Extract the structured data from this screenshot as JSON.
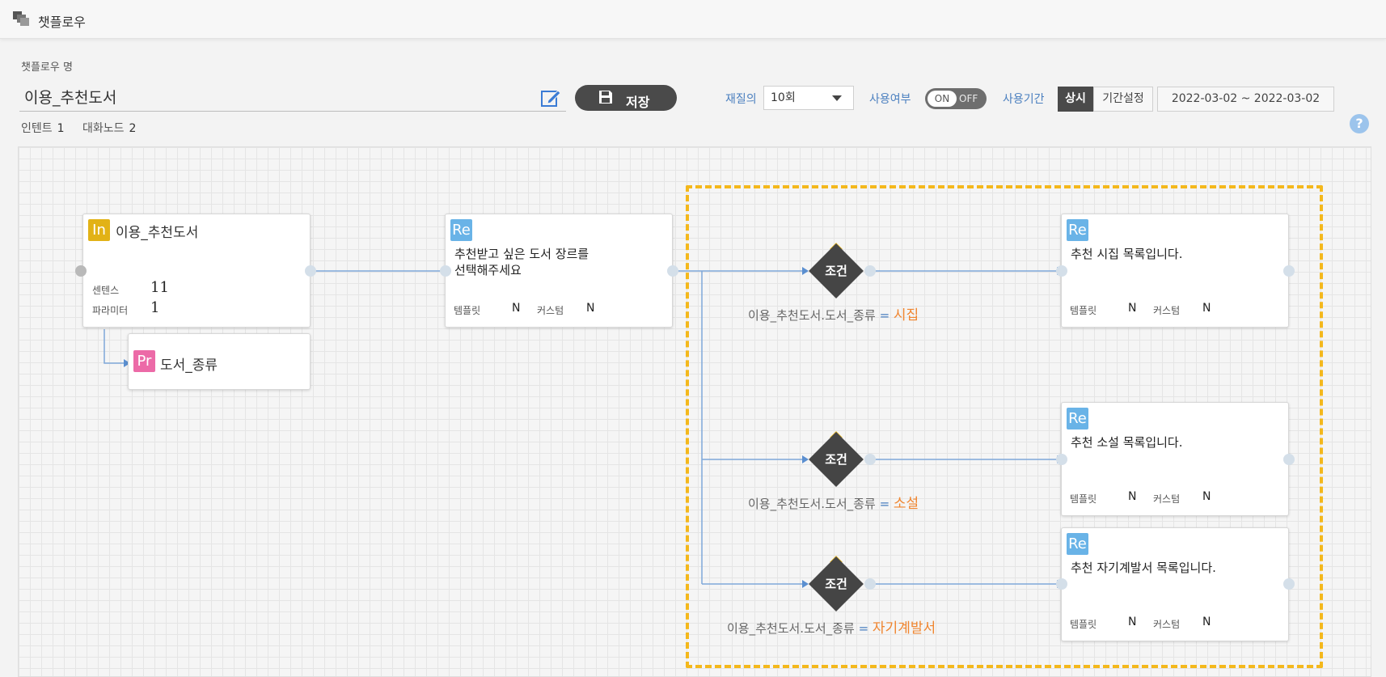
{
  "app": {
    "title": "챗플로우",
    "icon": "stacked-windows-icon"
  },
  "form": {
    "name_label": "챗플로우 명",
    "name_value": "이용_추천도서",
    "save_label": "저장",
    "intent_label": "인텐트",
    "intent_count": "1",
    "dialog_node_label": "대화노드",
    "dialog_node_count": "2",
    "retry_label": "재질의",
    "retry_value": "10회",
    "usage_label": "사용여부",
    "toggle_on": "ON",
    "toggle_off": "OFF",
    "period_label": "사용기간",
    "period_always": "상시",
    "period_setting": "기간설정",
    "date_range": "2022-03-02 ~ 2022-03-02",
    "help": "?"
  },
  "nodes": {
    "intent": {
      "badge": "In",
      "title": "이용_추천도서",
      "sentence_label": "센텐스",
      "sentence_count": "11",
      "param_label": "파라미터",
      "param_count": "1"
    },
    "param": {
      "badge": "Pr",
      "title": "도서_종류"
    },
    "response_main": {
      "badge": "Re",
      "text_line1": "추천받고 싶은 도서 장르를",
      "text_line2": "선택해주세요",
      "template_label": "템플릿",
      "template_value": "N",
      "custom_label": "커스텀",
      "custom_value": "N"
    },
    "conditions": [
      {
        "label": "조건",
        "expr": "이용_추천도서.도서_종류",
        "eq": "=",
        "value": "시집"
      },
      {
        "label": "조건",
        "expr": "이용_추천도서.도서_종류",
        "eq": "=",
        "value": "소설"
      },
      {
        "label": "조건",
        "expr": "이용_추천도서.도서_종류",
        "eq": "=",
        "value": "자기계발서"
      }
    ],
    "responses": [
      {
        "badge": "Re",
        "text": "추천 시집 목록입니다.",
        "template_label": "템플릿",
        "template_value": "N",
        "custom_label": "커스텀",
        "custom_value": "N"
      },
      {
        "badge": "Re",
        "text": "추천 소설 목록입니다.",
        "template_label": "템플릿",
        "template_value": "N",
        "custom_label": "커스텀",
        "custom_value": "N"
      },
      {
        "badge": "Re",
        "text": "추천 자기계발서 목록입니다.",
        "template_label": "템플릿",
        "template_value": "N",
        "custom_label": "커스텀",
        "custom_value": "N"
      }
    ]
  },
  "colors": {
    "accent_blue": "#4a7fbf",
    "highlight_orange": "#f0852f",
    "group_border": "#f4b81c",
    "dark": "#454545"
  }
}
